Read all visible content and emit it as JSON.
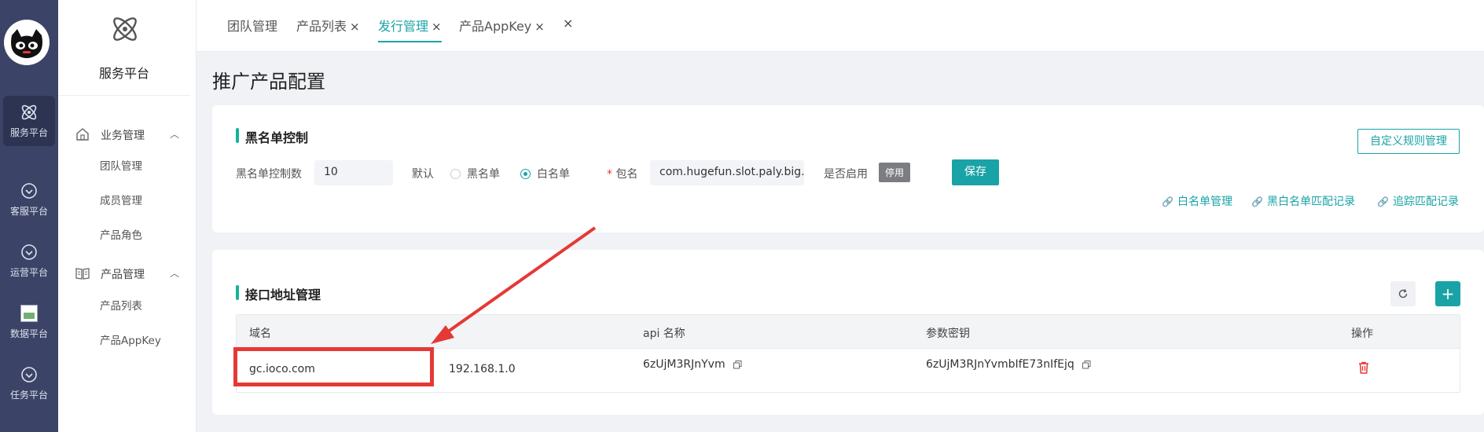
{
  "rail": {
    "items": [
      {
        "label": "服务平台",
        "icon": "atom-icon"
      },
      {
        "label": "客服平台",
        "icon": "chevron-circle-icon"
      },
      {
        "label": "运营平台",
        "icon": "chevron-circle-icon"
      },
      {
        "label": "数据平台",
        "icon": "broken-image-icon"
      },
      {
        "label": "任务平台",
        "icon": "chevron-circle-icon"
      }
    ]
  },
  "sidebar": {
    "title": "服务平台",
    "groups": [
      {
        "label": "业务管理",
        "icon": "home-icon",
        "children": [
          "团队管理",
          "成员管理",
          "产品角色"
        ]
      },
      {
        "label": "产品管理",
        "icon": "book-icon",
        "children": [
          "产品列表",
          "产品AppKey"
        ]
      }
    ]
  },
  "tabs": [
    {
      "label": "团队管理",
      "closable": false
    },
    {
      "label": "产品列表",
      "closable": true
    },
    {
      "label": "发行管理",
      "closable": true,
      "active": true
    },
    {
      "label": "产品AppKey",
      "closable": true
    }
  ],
  "tabs_close_glyph": "×",
  "page_title": "推广产品配置",
  "blacklist": {
    "title": "黑名单控制",
    "count_label": "黑名单控制数",
    "count_value": "10",
    "default_label": "默认",
    "option_black": "黑名单",
    "option_white": "白名单",
    "selected": "白名单",
    "required_mark": "*",
    "package_label": "包名",
    "package_value": "com.hugefun.slot.paly.big.g",
    "enable_label": "是否启用",
    "enable_status": "停用",
    "save_label": "保存",
    "custom_rules_label": "自定义规则管理",
    "links": [
      "白名单管理",
      "黑白名单匹配记录",
      "追踪匹配记录"
    ]
  },
  "api": {
    "title": "接口地址管理",
    "columns": [
      "域名",
      "",
      "api 名称",
      "参数密钥",
      "操作"
    ],
    "rows": [
      {
        "domain": "gc.ioco.com",
        "ip": "192.168.1.0",
        "api_name": "6zUjM3RJnYvm",
        "secret": "6zUjM3RJnYvmbIfE73nIfEjq"
      }
    ]
  },
  "colors": {
    "accent": "#1aa3a6",
    "rail": "#3b4466",
    "highlight": "#e53935",
    "danger": "#e53935"
  }
}
